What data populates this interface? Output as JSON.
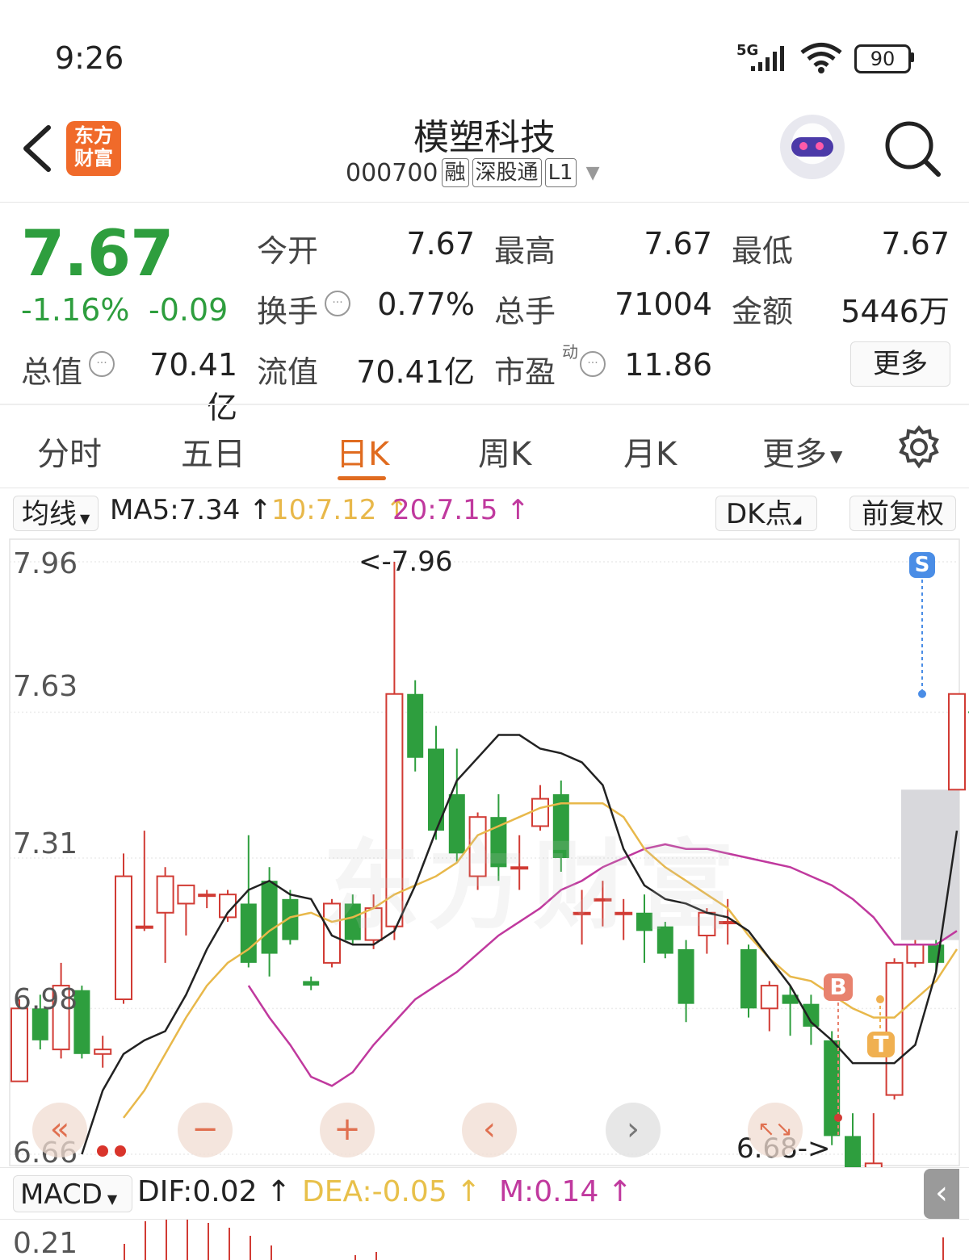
{
  "status": {
    "time": "9:26",
    "network": "5G",
    "battery": "90"
  },
  "header": {
    "logo_line1": "东方",
    "logo_line2": "财富",
    "title": "模塑科技",
    "code": "000700",
    "tags": [
      "融",
      "深股通",
      "L1"
    ]
  },
  "quote": {
    "price": "7.67",
    "change_pct": "-1.16%",
    "change": "-0.09",
    "stats": [
      {
        "label": "今开",
        "value": "7.67",
        "green": true
      },
      {
        "label": "最高",
        "value": "7.67",
        "green": true
      },
      {
        "label": "最低",
        "value": "7.67",
        "green": true
      },
      {
        "label": "换手",
        "value": "0.77%",
        "green": false
      },
      {
        "label": "总手",
        "value": "71004",
        "green": false
      },
      {
        "label": "金额",
        "value": "5446万",
        "green": false
      }
    ],
    "total_value_label": "总值",
    "total_value": "70.41亿",
    "float_value_label": "流值",
    "float_value": "70.41亿",
    "pe_label": "市盈",
    "pe_sup": "动",
    "pe_value": "11.86",
    "more": "更多"
  },
  "tabs": {
    "items": [
      "分时",
      "五日",
      "日K",
      "周K",
      "月K",
      "更多"
    ],
    "active": "日K"
  },
  "indicators": {
    "select": "均线",
    "ma5": "MA5:7.34",
    "ma10": "10:7.12",
    "ma20": "20:7.15",
    "dk": "DK点",
    "adjust": "前复权"
  },
  "colors": {
    "up": "#d13b34",
    "down": "#2e9e3e",
    "ma5": "#222222",
    "ma10": "#e8b84a",
    "ma20": "#c0399e",
    "accent": "#e06b1f"
  },
  "chart": {
    "y_labels": [
      "7.96",
      "7.63",
      "7.31",
      "6.98",
      "6.66"
    ],
    "high_marker": "<-7.96",
    "low_marker": "6.68->",
    "signals": [
      "S",
      "B",
      "T"
    ]
  },
  "chart_data": {
    "type": "candlestick",
    "ylim": [
      6.66,
      7.96
    ],
    "y_ticks": [
      7.96,
      7.63,
      7.31,
      6.98,
      6.66
    ],
    "candles": [
      {
        "o": 6.82,
        "c": 6.98,
        "h": 7.0,
        "l": 6.82
      },
      {
        "o": 6.98,
        "c": 6.91,
        "h": 7.01,
        "l": 6.89
      },
      {
        "o": 6.89,
        "c": 7.03,
        "h": 7.08,
        "l": 6.87
      },
      {
        "o": 7.02,
        "c": 6.88,
        "h": 7.03,
        "l": 6.87
      },
      {
        "o": 6.88,
        "c": 6.89,
        "h": 6.92,
        "l": 6.85
      },
      {
        "o": 7.0,
        "c": 7.27,
        "h": 7.32,
        "l": 6.99
      },
      {
        "o": 7.16,
        "c": 7.16,
        "h": 7.37,
        "l": 7.15
      },
      {
        "o": 7.19,
        "c": 7.27,
        "h": 7.29,
        "l": 7.08
      },
      {
        "o": 7.21,
        "c": 7.25,
        "h": 7.25,
        "l": 7.14
      },
      {
        "o": 7.23,
        "c": 7.23,
        "h": 7.24,
        "l": 7.2
      },
      {
        "o": 7.18,
        "c": 7.23,
        "h": 7.24,
        "l": 7.17
      },
      {
        "o": 7.21,
        "c": 7.08,
        "h": 7.36,
        "l": 7.07
      },
      {
        "o": 7.26,
        "c": 7.1,
        "h": 7.29,
        "l": 7.05
      },
      {
        "o": 7.22,
        "c": 7.13,
        "h": 7.24,
        "l": 7.12
      },
      {
        "o": 7.04,
        "c": 7.03,
        "h": 7.05,
        "l": 7.02
      },
      {
        "o": 7.08,
        "c": 7.21,
        "h": 7.22,
        "l": 7.07
      },
      {
        "o": 7.21,
        "c": 7.13,
        "h": 7.23,
        "l": 7.12
      },
      {
        "o": 7.13,
        "c": 7.2,
        "h": 7.23,
        "l": 7.11
      },
      {
        "o": 7.16,
        "c": 7.67,
        "h": 7.96,
        "l": 7.13
      },
      {
        "o": 7.67,
        "c": 7.53,
        "h": 7.7,
        "l": 7.5
      },
      {
        "o": 7.55,
        "c": 7.37,
        "h": 7.6,
        "l": 7.35
      },
      {
        "o": 7.45,
        "c": 7.32,
        "h": 7.55,
        "l": 7.3
      },
      {
        "o": 7.27,
        "c": 7.4,
        "h": 7.41,
        "l": 7.24
      },
      {
        "o": 7.4,
        "c": 7.29,
        "h": 7.45,
        "l": 7.26
      },
      {
        "o": 7.29,
        "c": 7.29,
        "h": 7.36,
        "l": 7.24
      },
      {
        "o": 7.38,
        "c": 7.44,
        "h": 7.47,
        "l": 7.37
      },
      {
        "o": 7.45,
        "c": 7.31,
        "h": 7.48,
        "l": 7.28
      },
      {
        "o": 7.19,
        "c": 7.19,
        "h": 7.24,
        "l": 7.12
      },
      {
        "o": 7.22,
        "c": 7.22,
        "h": 7.26,
        "l": 7.16
      },
      {
        "o": 7.19,
        "c": 7.19,
        "h": 7.22,
        "l": 7.13
      },
      {
        "o": 7.19,
        "c": 7.15,
        "h": 7.23,
        "l": 7.08
      },
      {
        "o": 7.16,
        "c": 7.1,
        "h": 7.17,
        "l": 7.09
      },
      {
        "o": 7.11,
        "c": 6.99,
        "h": 7.13,
        "l": 6.95
      },
      {
        "o": 7.14,
        "c": 7.19,
        "h": 7.2,
        "l": 7.1
      },
      {
        "o": 7.17,
        "c": 7.17,
        "h": 7.22,
        "l": 7.12
      },
      {
        "o": 7.11,
        "c": 6.98,
        "h": 7.12,
        "l": 6.96
      },
      {
        "o": 6.98,
        "c": 7.03,
        "h": 7.04,
        "l": 6.93
      },
      {
        "o": 7.01,
        "c": 6.99,
        "h": 7.03,
        "l": 6.92
      },
      {
        "o": 6.99,
        "c": 6.94,
        "h": 7.01,
        "l": 6.9
      },
      {
        "o": 6.91,
        "c": 6.7,
        "h": 6.93,
        "l": 6.68
      },
      {
        "o": 6.7,
        "c": 6.62,
        "h": 6.75,
        "l": 6.61
      },
      {
        "o": 6.62,
        "c": 6.64,
        "h": 6.75,
        "l": 6.61
      },
      {
        "o": 6.79,
        "c": 7.08,
        "h": 7.09,
        "l": 6.78
      },
      {
        "o": 7.08,
        "c": 7.12,
        "h": 7.13,
        "l": 7.07
      },
      {
        "o": 7.12,
        "c": 7.08,
        "h": 7.13,
        "l": 7.06
      },
      {
        "o": 7.46,
        "c": 7.67,
        "h": 7.67,
        "l": 7.46
      }
    ],
    "ma5": [
      6.66,
      6.8,
      6.88,
      6.91,
      6.93,
      7.01,
      7.11,
      7.19,
      7.24,
      7.26,
      7.23,
      7.22,
      7.14,
      7.12,
      7.12,
      7.15,
      7.25,
      7.37,
      7.48,
      7.53,
      7.58,
      7.58,
      7.55,
      7.54,
      7.52,
      7.47,
      7.33,
      7.25,
      7.22,
      7.21,
      7.19,
      7.18,
      7.15,
      7.09,
      7.03,
      6.95,
      6.91,
      6.86,
      6.86,
      6.86,
      6.9,
      7.06,
      7.37
    ],
    "ma10": [
      6.74,
      6.8,
      6.88,
      6.96,
      7.03,
      7.08,
      7.11,
      7.15,
      7.18,
      7.19,
      7.17,
      7.18,
      7.2,
      7.23,
      7.25,
      7.27,
      7.3,
      7.36,
      7.38,
      7.4,
      7.42,
      7.43,
      7.43,
      7.43,
      7.4,
      7.33,
      7.29,
      7.26,
      7.23,
      7.2,
      7.14,
      7.09,
      7.05,
      7.04,
      7.01,
      6.98,
      6.96,
      6.96,
      7.0,
      7.04,
      7.11
    ],
    "ma20": [
      7.03,
      6.96,
      6.9,
      6.83,
      6.81,
      6.84,
      6.9,
      6.95,
      7.0,
      7.03,
      7.06,
      7.1,
      7.14,
      7.17,
      7.2,
      7.24,
      7.26,
      7.29,
      7.31,
      7.33,
      7.34,
      7.33,
      7.33,
      7.32,
      7.31,
      7.3,
      7.29,
      7.27,
      7.25,
      7.22,
      7.18,
      7.12,
      7.12,
      7.12,
      7.15
    ]
  },
  "controls": [
    "«",
    "−",
    "+",
    "‹",
    "›",
    "↖↘"
  ],
  "macd": {
    "select": "MACD",
    "dif": "DIF:0.02",
    "dea": "DEA:-0.05",
    "m": "M:0.14",
    "y_label": "0.21"
  }
}
